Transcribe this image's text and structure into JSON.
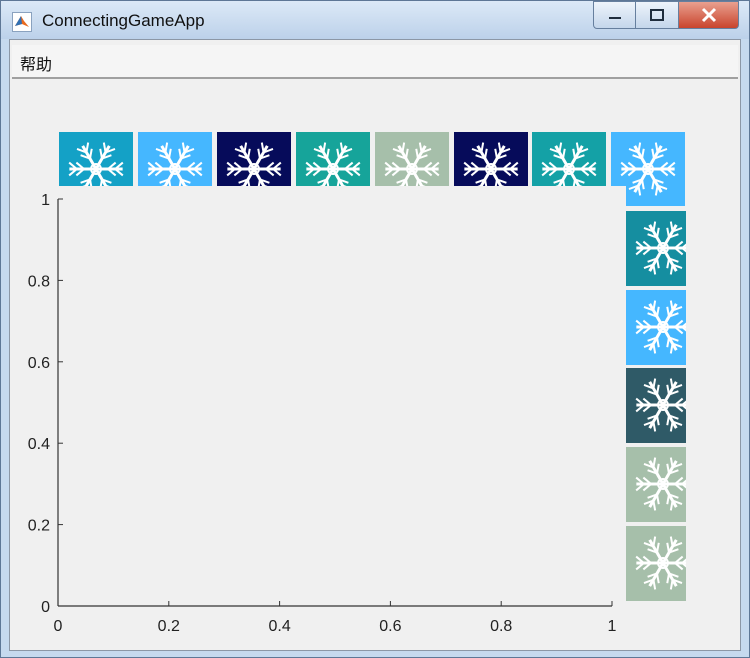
{
  "window": {
    "title": "ConnectingGameApp"
  },
  "menu": {
    "items": [
      "帮助"
    ]
  },
  "tiles": {
    "top": [
      {
        "bg": "#14a1c6",
        "icon": "ornate-snowflake-icon"
      },
      {
        "bg": "#45b7ff",
        "icon": "snowflake-icon"
      },
      {
        "bg": "#060b5a",
        "icon": "lace-snowflake-icon"
      },
      {
        "bg": "#16a49a",
        "icon": "snowflake-icon"
      },
      {
        "bg": "#a6bfaa",
        "icon": "snowflake-icon"
      },
      {
        "bg": "#060b5a",
        "icon": "lace-snowflake-icon"
      },
      {
        "bg": "#14a1a6",
        "icon": "snowflake-icon"
      },
      {
        "bg": "#45b7ff",
        "icon": "snowflake-icon"
      }
    ],
    "right": [
      {
        "bg": "#158ea0",
        "icon": "mandala-snowflake-icon"
      },
      {
        "bg": "#45b7ff",
        "icon": "snowflake-icon"
      },
      {
        "bg": "#2f5a67",
        "icon": "snowflake-icon"
      },
      {
        "bg": "#a6bfaa",
        "icon": "snowflake-icon"
      },
      {
        "bg": "#a6bfaa",
        "icon": "snowflake-icon"
      }
    ]
  },
  "chart_data": {
    "type": "scatter",
    "title": "",
    "xlabel": "",
    "ylabel": "",
    "xlim": [
      0,
      1
    ],
    "ylim": [
      0,
      1
    ],
    "xticks": [
      "0",
      "0.2",
      "0.4",
      "0.6",
      "0.8",
      "1"
    ],
    "yticks": [
      "0",
      "0.2",
      "0.4",
      "0.6",
      "0.8",
      "1"
    ],
    "series": [],
    "grid": false
  }
}
